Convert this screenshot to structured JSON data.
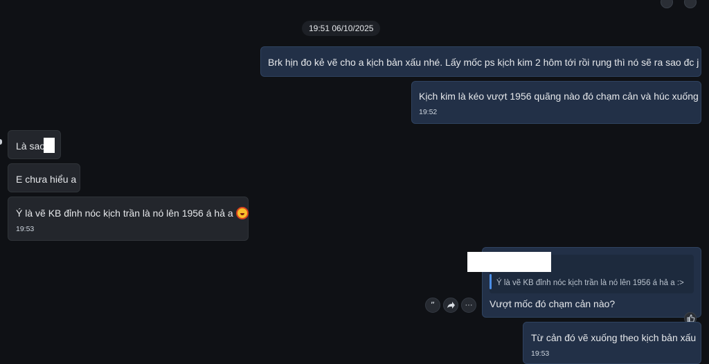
{
  "chat": {
    "date_separator": "19:51 06/10/2025",
    "messages": [
      {
        "side": "out",
        "text": "Brk hịn đo kẻ vẽ cho a kịch bản xấu nhé. Lấy mốc ps kịch kim 2 hôm tới rồi rụng thì nó sẽ ra sao đc j"
      },
      {
        "side": "out",
        "text": "Kịch kim là kéo vượt 1956 quãng nào đó chạm cản và húc xuống",
        "time": "19:52"
      },
      {
        "side": "in",
        "text": "Là sao"
      },
      {
        "side": "in",
        "text": "E chưa hiểu a"
      },
      {
        "side": "in",
        "text": "Ý là vẽ KB đỉnh nóc kịch trần là nó lên 1956 á hả a",
        "time": "19:53",
        "emoji": "grinning-face-emoji"
      },
      {
        "side": "out",
        "quote": "Ý là vẽ KB đỉnh nóc kịch trần là nó lên 1956 á hả a :>",
        "text": "Vượt mốc đó chạm cản nào?"
      },
      {
        "side": "out",
        "text": "Từ cản đó vẽ xuống theo kịch bản xấu",
        "time": "19:53"
      }
    ],
    "actions": {
      "quote_icon": "quote-icon",
      "forward_icon": "forward-icon",
      "more_icon": "more-icon",
      "more_label": "···"
    },
    "reaction_icon": "thumbs-up-icon"
  }
}
